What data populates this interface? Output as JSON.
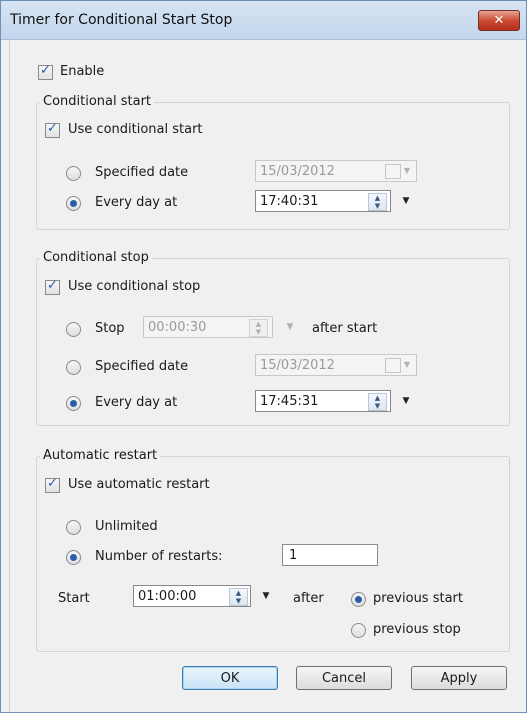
{
  "window": {
    "title": "Timer for Conditional Start Stop",
    "close_glyph": "✕"
  },
  "enable": {
    "label": "Enable",
    "checked": true
  },
  "conditional_start": {
    "title": "Conditional start",
    "use_label": "Use conditional start",
    "specified_date_label": "Specified date",
    "specified_date_value": "15/03/2012",
    "every_day_label": "Every day at",
    "every_day_value": "17:40:31",
    "selected": "every_day"
  },
  "conditional_stop": {
    "title": "Conditional stop",
    "use_label": "Use conditional stop",
    "stop_label": "Stop",
    "stop_value": "00:00:30",
    "after_start_label": "after start",
    "specified_date_label": "Specified date",
    "specified_date_value": "15/03/2012",
    "every_day_label": "Every day at",
    "every_day_value": "17:45:31",
    "selected": "every_day"
  },
  "automatic_restart": {
    "title": "Automatic restart",
    "use_label": "Use automatic restart",
    "unlimited_label": "Unlimited",
    "number_label": "Number of restarts:",
    "number_value": "1",
    "start_label": "Start",
    "start_value": "01:00:00",
    "after_label": "after",
    "previous_start_label": "previous start",
    "previous_stop_label": "previous stop",
    "selected_count": "number",
    "selected_after": "previous_start"
  },
  "buttons": {
    "ok": "OK",
    "cancel": "Cancel",
    "apply": "Apply"
  },
  "icons": {
    "spin": "spin-up-down-icon",
    "dropdown": "chevron-down-icon",
    "calendar": "calendar-icon",
    "check": "checkmark-icon",
    "close": "close-icon"
  }
}
